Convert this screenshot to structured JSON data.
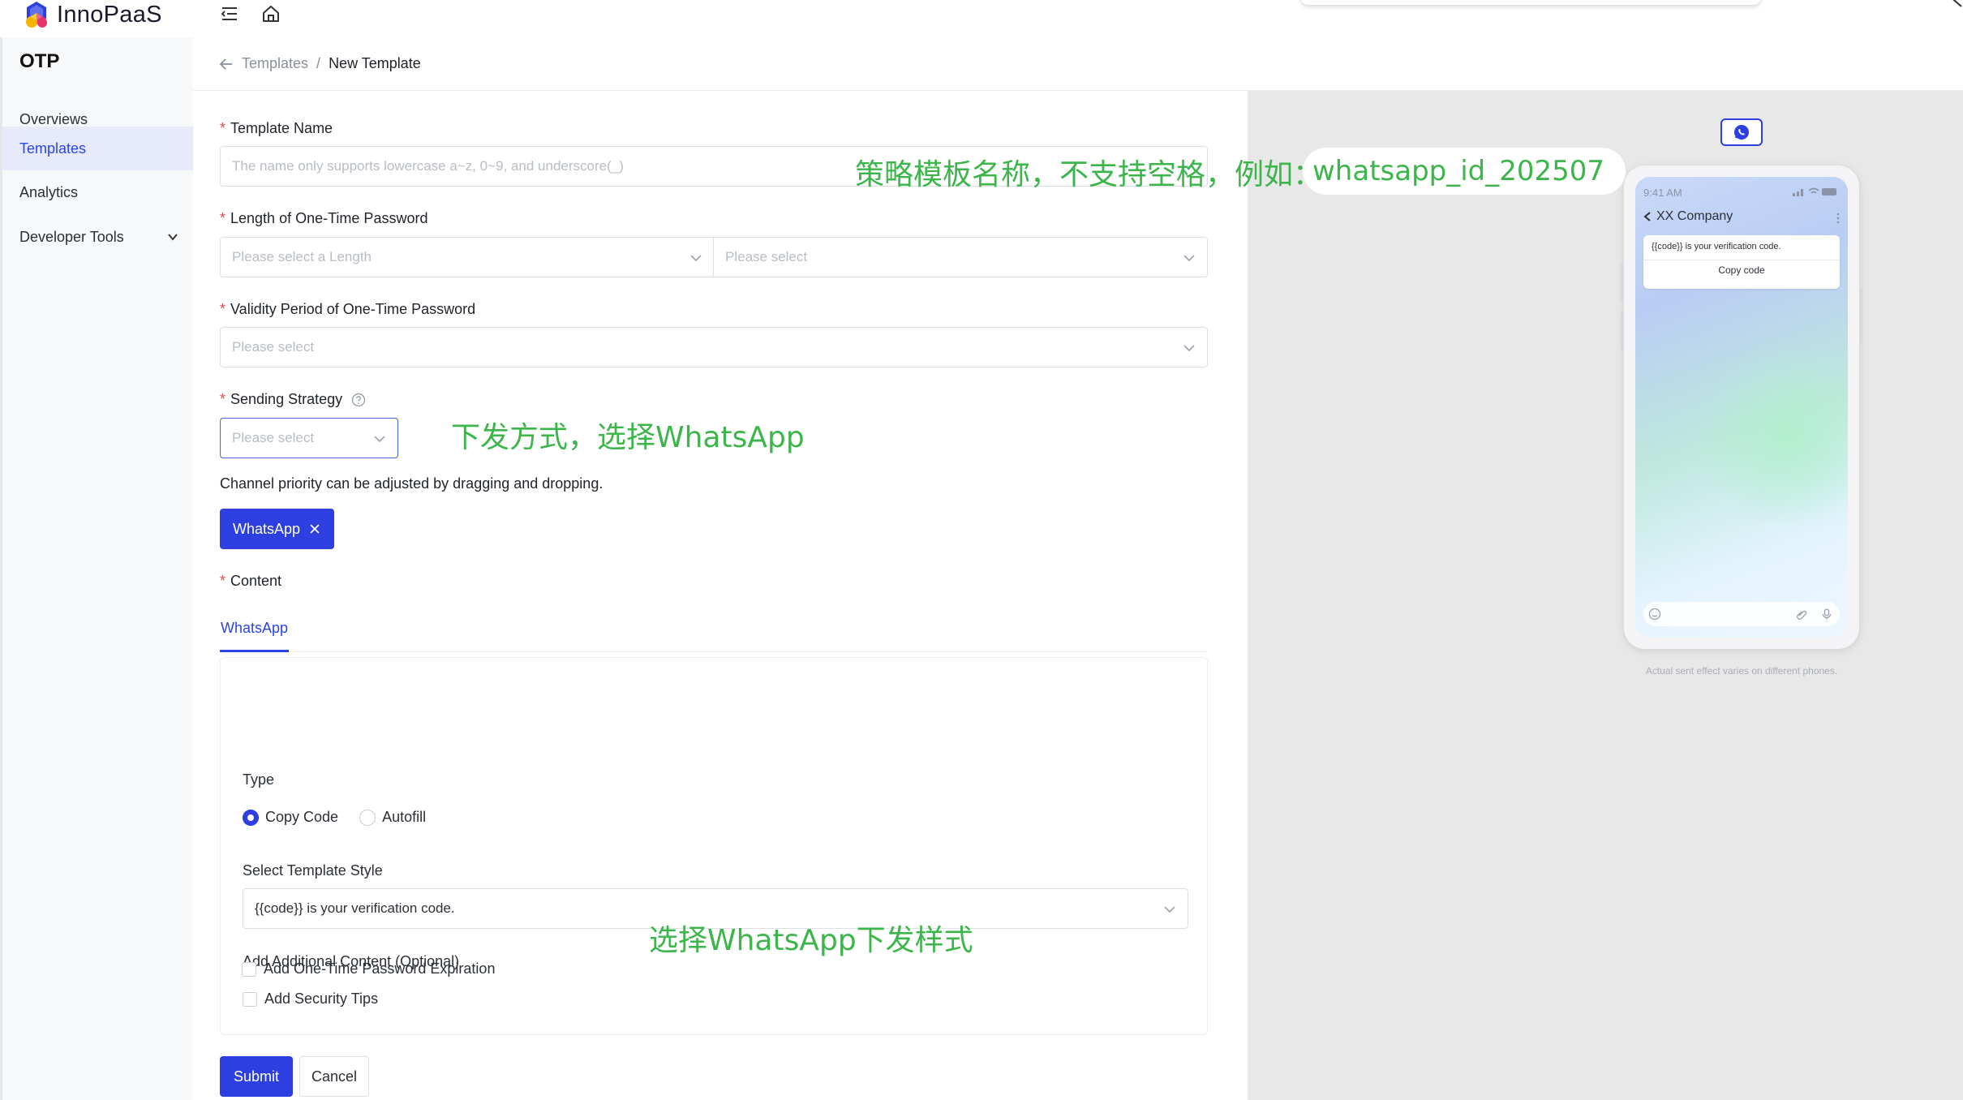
{
  "app": {
    "brand": "InnoPaaS",
    "brand_colors": [
      "#2d3fe0",
      "#f5b400",
      "#e8336d"
    ]
  },
  "sidebar": {
    "title": "OTP",
    "items": [
      {
        "label": "Overviews",
        "active": false
      },
      {
        "label": "Templates",
        "active": true
      },
      {
        "label": "Analytics",
        "active": false
      },
      {
        "label": "Developer Tools",
        "active": false,
        "expandable": true
      }
    ]
  },
  "breadcrumb": {
    "parent": "Templates",
    "separator": "/",
    "current": "New Template"
  },
  "form": {
    "template_name": {
      "label": "Template Name",
      "placeholder": "The name only supports lowercase a~z, 0~9, and underscore(_)"
    },
    "otp_length": {
      "label": "Length of One-Time Password",
      "placeholder_length": "Please select a Length",
      "placeholder_type": "Please select"
    },
    "validity": {
      "label": "Validity Period of One-Time Password",
      "placeholder": "Please select"
    },
    "sending_strategy": {
      "label": "Sending Strategy",
      "placeholder": "Please select"
    },
    "channel_hint": "Channel priority can be adjusted by dragging and dropping.",
    "channel_chip": "WhatsApp",
    "content": {
      "label": "Content",
      "tab": "WhatsApp",
      "type_label": "Type",
      "type_options": [
        "Copy Code",
        "Autofill"
      ],
      "type_selected": "Copy Code",
      "style_label": "Select Template Style",
      "style_value": "{{code}} is your verification code.",
      "additional_label": "Add Additional Content (Optional)",
      "security_tips": "Add Security Tips",
      "expiration": "Add One-Time Password Expiration"
    },
    "submit": "Submit",
    "cancel": "Cancel"
  },
  "preview": {
    "status_time": "9:41 AM",
    "company": "XX Company",
    "message": "{{code}}  is your verification code.",
    "copy_button": "Copy code",
    "note": "Actual sent effect varies on different phones."
  },
  "annotations": {
    "name_hint_prefix": "策略模板名称，不支持空格，例如：",
    "name_hint_example": "whatsapp_id_202507",
    "strategy_hint": "下发方式，选择WhatsApp",
    "style_hint": "选择WhatsApp下发样式",
    "color": "#3cb54a"
  }
}
